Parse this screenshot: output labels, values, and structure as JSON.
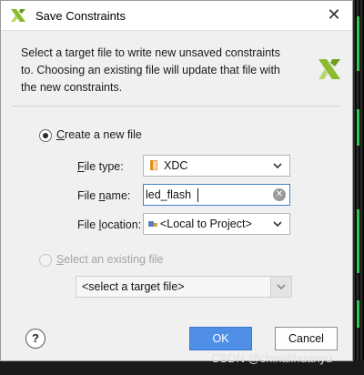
{
  "window": {
    "title": "Save Constraints",
    "close_glyph": "✕"
  },
  "intro_text": "Select a target file to write new unsaved constraints to. Choosing an existing file will update that file with the new constraints.",
  "create_new": {
    "label_prefix": "",
    "label_mnemonic": "C",
    "label_rest": "reate a new file",
    "selected": true,
    "file_type": {
      "label_mnemonic": "F",
      "label_rest": "ile type:",
      "value": "XDC",
      "icon": "xdc-file-icon"
    },
    "file_name": {
      "label_pre": "File ",
      "label_mnemonic": "n",
      "label_rest": "ame:",
      "value": "led_flash"
    },
    "file_location": {
      "label_pre": "File ",
      "label_mnemonic": "l",
      "label_rest": "ocation:",
      "value": "<Local to Project>",
      "icon": "local-folder-icon"
    }
  },
  "select_existing": {
    "label_mnemonic": "S",
    "label_rest": "elect an existing file",
    "selected": false,
    "enabled": false,
    "dropdown_value": "<select a target file>"
  },
  "buttons": {
    "help": "?",
    "ok": "OK",
    "cancel": "Cancel"
  },
  "watermark": "CSDN @chinalihuanyu",
  "colors": {
    "ok_button": "#4f8fe8",
    "logo_green": "#8cbb2e",
    "dialog_bg": "#f0f0f0"
  }
}
